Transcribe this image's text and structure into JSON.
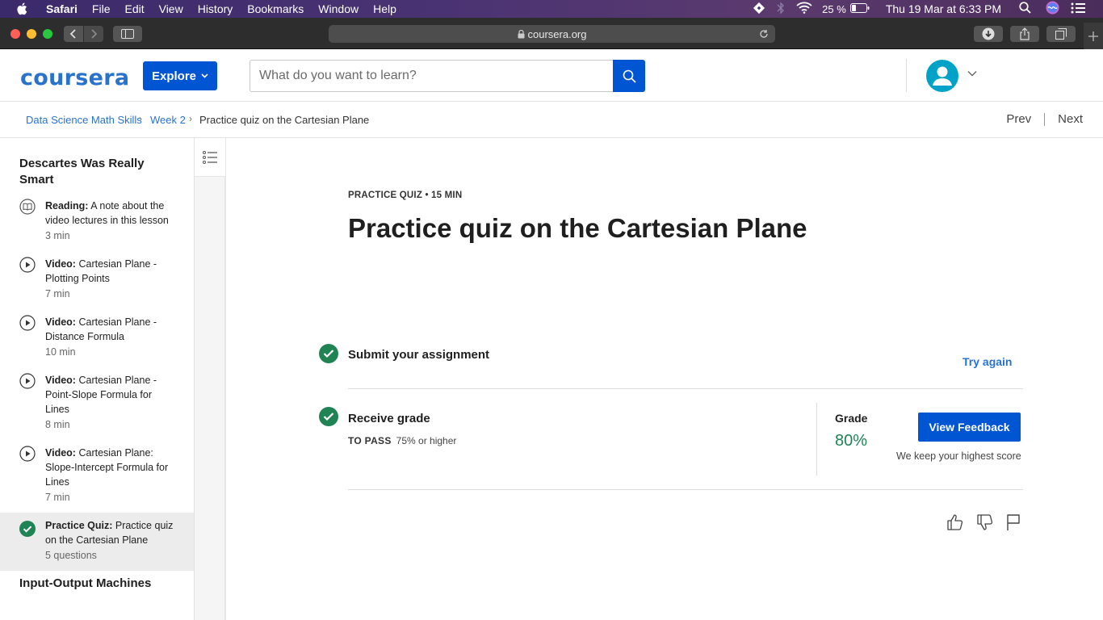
{
  "menubar": {
    "app": "Safari",
    "items": [
      "File",
      "Edit",
      "View",
      "History",
      "Bookmarks",
      "Window",
      "Help"
    ],
    "battery": "25 %",
    "datetime": "Thu 19 Mar at  6:33 PM"
  },
  "browser": {
    "url": "coursera.org"
  },
  "header": {
    "logo": "coursera",
    "explore_label": "Explore",
    "search_placeholder": "What do you want to learn?"
  },
  "breadcrumb": {
    "course": "Data Science Math Skills",
    "week": "Week 2",
    "current": "Practice quiz on the Cartesian Plane",
    "prev": "Prev",
    "next": "Next"
  },
  "sidebar": {
    "lesson_title": "Descartes Was Really Smart",
    "items": [
      {
        "type": "Reading:",
        "title": "A note about the video lectures in this lesson",
        "meta": "3 min",
        "icon": "book-icon"
      },
      {
        "type": "Video:",
        "title": "Cartesian Plane - Plotting Points",
        "meta": "7 min",
        "icon": "play-icon"
      },
      {
        "type": "Video:",
        "title": "Cartesian Plane - Distance Formula",
        "meta": "10 min",
        "icon": "play-icon"
      },
      {
        "type": "Video:",
        "title": "Cartesian Plane - Point-Slope Formula for Lines",
        "meta": "8 min",
        "icon": "play-icon"
      },
      {
        "type": "Video:",
        "title": "Cartesian Plane: Slope-Intercept Formula for Lines",
        "meta": "7 min",
        "icon": "play-icon"
      },
      {
        "type": "Practice Quiz:",
        "title": "Practice quiz on the Cartesian Plane",
        "meta": "5 questions",
        "icon": "check-circle-icon"
      }
    ],
    "next_lesson_title": "Input-Output Machines"
  },
  "main": {
    "kicker": "PRACTICE QUIZ • 15 MIN",
    "title": "Practice quiz on the Cartesian Plane",
    "submit_label": "Submit your assignment",
    "try_again": "Try again",
    "receive_label": "Receive grade",
    "to_pass_label": "TO PASS",
    "to_pass_value": "75% or higher",
    "grade_label": "Grade",
    "grade_value": "80%",
    "view_feedback": "View Feedback",
    "keep_note": "We keep your highest score"
  },
  "colors": {
    "brand": "#0056d2",
    "link": "#2a73cc",
    "success": "#1f8354"
  }
}
